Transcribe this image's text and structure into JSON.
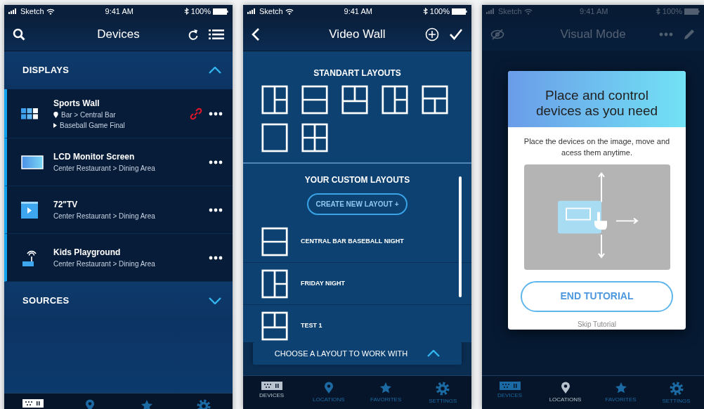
{
  "devices_screen": {
    "status_bar": {
      "carrier": "Sketch",
      "time": "9:41 AM",
      "battery": "100%"
    },
    "title": "Devices",
    "sections": [
      {
        "title": "DISPLAYS",
        "expanded": true,
        "items": [
          {
            "kind": "wall",
            "name": "Sports Wall",
            "location": "Bar > Central Bar",
            "now_playing": "Baseball Game Final",
            "linked": true
          },
          {
            "kind": "monitor",
            "name": "LCD Monitor Screen",
            "location": "Center Restaurant > Dining Area",
            "linked": false
          },
          {
            "kind": "tv",
            "name": "72\"TV",
            "location": "Center Restaurant > Dining Area",
            "linked": false
          },
          {
            "kind": "router",
            "name": "Kids Playground",
            "location": "Center Restaurant > Dining Area",
            "linked": false
          }
        ]
      },
      {
        "title": "SOURCES",
        "expanded": false
      }
    ],
    "tab_bar": [
      {
        "selected": true
      },
      {
        "selected": false
      },
      {
        "selected": false
      },
      {
        "selected": false
      }
    ]
  },
  "video_wall_screen": {
    "status_bar": {
      "carrier": "Sketch",
      "time": "9:41 AM",
      "battery": "100%"
    },
    "title": "Video Wall",
    "standard_title": "STANDART LAYOUTS",
    "standard_layouts": [
      {
        "kind": "v-split-right-h"
      },
      {
        "kind": "h-split"
      },
      {
        "kind": "top-v-split"
      },
      {
        "kind": "v-split-right-h"
      },
      {
        "kind": "bottom-v-split"
      },
      {
        "kind": "single"
      },
      {
        "kind": "quad"
      }
    ],
    "custom_title": "YOUR CUSTOM LAYOUTS",
    "create_button": "CREATE NEW LAYOUT +",
    "custom_layouts": [
      {
        "kind": "h-split",
        "name": "CENTRAL BAR BASEBALL NIGHT"
      },
      {
        "kind": "v-split-right-h",
        "name": "FRIDAY NIGHT"
      },
      {
        "kind": "top-v-split",
        "name": "TEST 1"
      }
    ],
    "chooser": "CHOOSE A LAYOUT TO WORK WITH",
    "tab_bar": [
      {
        "label": "DEVICES",
        "selected": true
      },
      {
        "label": "LOCATIONS",
        "selected": false
      },
      {
        "label": "FAVORITES",
        "selected": false
      },
      {
        "label": "SETTINGS",
        "selected": false
      }
    ]
  },
  "visual_mode_screen": {
    "status_bar": {
      "carrier": "Sketch",
      "time": "9:41 AM",
      "battery": "100%"
    },
    "title": "Visual Mode",
    "dialog": {
      "title": "Place and control devices as you need",
      "text": "Place the devices on the image, move and acess them anytime.",
      "button": "END TUTORIAL",
      "link": "Skip Tutorial"
    },
    "tab_bar": [
      {
        "label": "DEVICES",
        "selected": false
      },
      {
        "label": "LOCATIONS",
        "selected": true
      },
      {
        "label": "FAVORITES",
        "selected": false
      },
      {
        "label": "SETTINGS",
        "selected": false
      }
    ]
  }
}
